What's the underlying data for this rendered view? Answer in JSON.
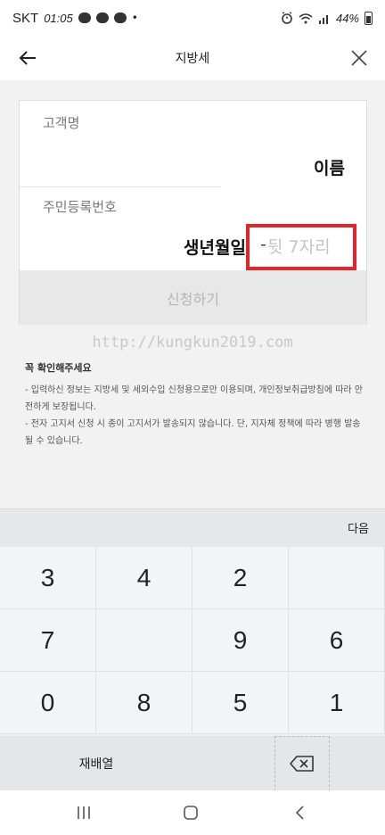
{
  "status_bar": {
    "carrier": "SKT",
    "time": "01:05",
    "battery": "44%"
  },
  "header": {
    "title": "지방세",
    "back_icon": "arrow-left-icon",
    "close_icon": "close-icon"
  },
  "form": {
    "name_label": "고객명",
    "name_value": "이름",
    "rrn_label": "주민등록번호",
    "rrn_front_value": "생년월일",
    "rrn_separator": "-",
    "rrn_back_placeholder": "뒷 7자리",
    "apply_button": "신청하기"
  },
  "watermark": "http://kungkun2019.com",
  "notice": {
    "title": "꼭 확인해주세요",
    "items": [
      "- 입력하신 정보는 지방세 및 세외수입 신청용으로만 이용되며, 개인정보취급방침에 따라 안전하게 보장됩니다.",
      "- 전자 고지서 신청 시 종이 고지서가 발송되지 않습니다. 단, 지자체 정책에 따라 병행 발송될 수 있습니다."
    ]
  },
  "keypad": {
    "next_label": "다음",
    "keys": [
      "3",
      "4",
      "2",
      "",
      "7",
      "",
      "9",
      "6",
      "0",
      "8",
      "5",
      "1"
    ],
    "rearrange_label": "재배열",
    "backspace_icon": "backspace-icon"
  },
  "colors": {
    "highlight_box": "#e0262b",
    "disabled_button_bg": "#e8e8e8",
    "disabled_button_text": "#b5b5b5"
  }
}
